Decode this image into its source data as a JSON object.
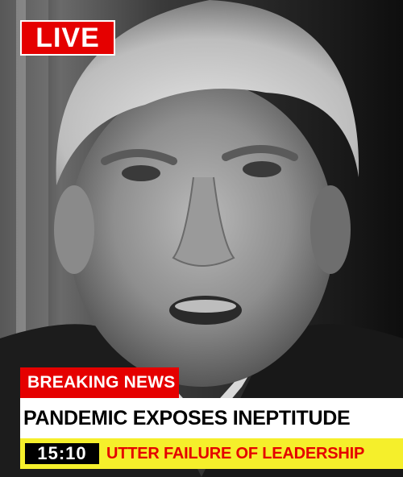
{
  "live_badge": {
    "label": "LIVE"
  },
  "lower_third": {
    "tag": "BREAKING NEWS",
    "headline": "PANDEMIC EXPOSES INEPTITUDE",
    "clock": "15:10",
    "ticker": "UTTER FAILURE OF LEADERSHIP"
  },
  "colors": {
    "accent_red": "#e50000",
    "ticker_yellow": "#f5ef2b",
    "headline_bg": "#ffffff"
  }
}
